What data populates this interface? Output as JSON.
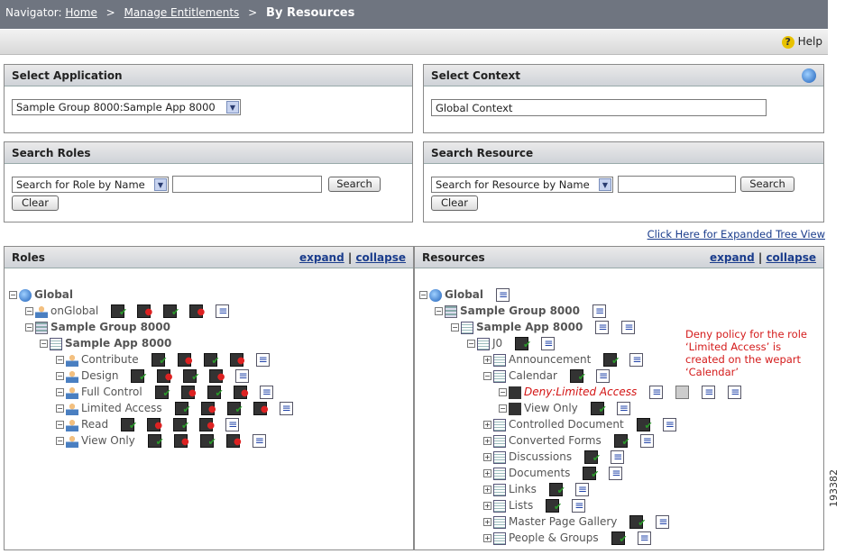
{
  "nav": {
    "label": "Navigator:",
    "crumbs": [
      "Home",
      "Manage Entitlements"
    ],
    "separator": ">",
    "current": "By Resources"
  },
  "help": {
    "label": "Help"
  },
  "select_application": {
    "title": "Select Application",
    "value": "Sample Group 8000:Sample App 8000"
  },
  "select_context": {
    "title": "Select Context",
    "value": "Global Context"
  },
  "search_roles": {
    "title": "Search Roles",
    "mode": "Search for Role by Name",
    "query": "",
    "search_label": "Search",
    "clear_label": "Clear"
  },
  "search_resource": {
    "title": "Search Resource",
    "mode": "Search for Resource by Name",
    "query": "",
    "search_label": "Search",
    "clear_label": "Clear"
  },
  "expanded_link": "Click Here for Expanded Tree View",
  "roles": {
    "title": "Roles",
    "expand": "expand",
    "collapse": "collapse",
    "sep": "|",
    "tree": [
      "Global",
      "onGlobal",
      "Sample Group 8000",
      "Sample App 8000",
      "Contribute",
      "Design",
      "Full Control",
      "Limited Access",
      "Read",
      "View Only"
    ]
  },
  "resources": {
    "title": "Resources",
    "expand": "expand",
    "collapse": "collapse",
    "sep": "|",
    "tree": [
      "Global",
      "Sample Group 8000",
      "Sample App 8000",
      "J0",
      "Announcement",
      "Calendar",
      "Deny:Limited Access",
      "View Only",
      "Controlled Document",
      "Converted Forms",
      "Discussions",
      "Documents",
      "Links",
      "Lists",
      "Master Page Gallery",
      "People & Groups"
    ]
  },
  "note": "Deny policy for the role ‘Limited Access’ is created on the wepart ‘Calendar’",
  "figure_code": "193382"
}
